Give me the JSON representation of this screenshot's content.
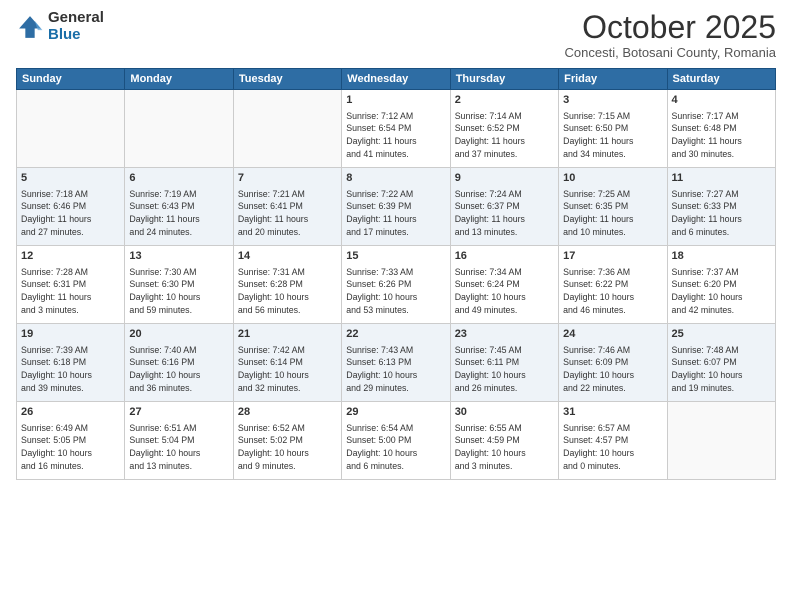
{
  "logo": {
    "general": "General",
    "blue": "Blue"
  },
  "title": "October 2025",
  "subtitle": "Concesti, Botosani County, Romania",
  "weekdays": [
    "Sunday",
    "Monday",
    "Tuesday",
    "Wednesday",
    "Thursday",
    "Friday",
    "Saturday"
  ],
  "weeks": [
    [
      {
        "day": "",
        "info": ""
      },
      {
        "day": "",
        "info": ""
      },
      {
        "day": "",
        "info": ""
      },
      {
        "day": "1",
        "info": "Sunrise: 7:12 AM\nSunset: 6:54 PM\nDaylight: 11 hours\nand 41 minutes."
      },
      {
        "day": "2",
        "info": "Sunrise: 7:14 AM\nSunset: 6:52 PM\nDaylight: 11 hours\nand 37 minutes."
      },
      {
        "day": "3",
        "info": "Sunrise: 7:15 AM\nSunset: 6:50 PM\nDaylight: 11 hours\nand 34 minutes."
      },
      {
        "day": "4",
        "info": "Sunrise: 7:17 AM\nSunset: 6:48 PM\nDaylight: 11 hours\nand 30 minutes."
      }
    ],
    [
      {
        "day": "5",
        "info": "Sunrise: 7:18 AM\nSunset: 6:46 PM\nDaylight: 11 hours\nand 27 minutes."
      },
      {
        "day": "6",
        "info": "Sunrise: 7:19 AM\nSunset: 6:43 PM\nDaylight: 11 hours\nand 24 minutes."
      },
      {
        "day": "7",
        "info": "Sunrise: 7:21 AM\nSunset: 6:41 PM\nDaylight: 11 hours\nand 20 minutes."
      },
      {
        "day": "8",
        "info": "Sunrise: 7:22 AM\nSunset: 6:39 PM\nDaylight: 11 hours\nand 17 minutes."
      },
      {
        "day": "9",
        "info": "Sunrise: 7:24 AM\nSunset: 6:37 PM\nDaylight: 11 hours\nand 13 minutes."
      },
      {
        "day": "10",
        "info": "Sunrise: 7:25 AM\nSunset: 6:35 PM\nDaylight: 11 hours\nand 10 minutes."
      },
      {
        "day": "11",
        "info": "Sunrise: 7:27 AM\nSunset: 6:33 PM\nDaylight: 11 hours\nand 6 minutes."
      }
    ],
    [
      {
        "day": "12",
        "info": "Sunrise: 7:28 AM\nSunset: 6:31 PM\nDaylight: 11 hours\nand 3 minutes."
      },
      {
        "day": "13",
        "info": "Sunrise: 7:30 AM\nSunset: 6:30 PM\nDaylight: 10 hours\nand 59 minutes."
      },
      {
        "day": "14",
        "info": "Sunrise: 7:31 AM\nSunset: 6:28 PM\nDaylight: 10 hours\nand 56 minutes."
      },
      {
        "day": "15",
        "info": "Sunrise: 7:33 AM\nSunset: 6:26 PM\nDaylight: 10 hours\nand 53 minutes."
      },
      {
        "day": "16",
        "info": "Sunrise: 7:34 AM\nSunset: 6:24 PM\nDaylight: 10 hours\nand 49 minutes."
      },
      {
        "day": "17",
        "info": "Sunrise: 7:36 AM\nSunset: 6:22 PM\nDaylight: 10 hours\nand 46 minutes."
      },
      {
        "day": "18",
        "info": "Sunrise: 7:37 AM\nSunset: 6:20 PM\nDaylight: 10 hours\nand 42 minutes."
      }
    ],
    [
      {
        "day": "19",
        "info": "Sunrise: 7:39 AM\nSunset: 6:18 PM\nDaylight: 10 hours\nand 39 minutes."
      },
      {
        "day": "20",
        "info": "Sunrise: 7:40 AM\nSunset: 6:16 PM\nDaylight: 10 hours\nand 36 minutes."
      },
      {
        "day": "21",
        "info": "Sunrise: 7:42 AM\nSunset: 6:14 PM\nDaylight: 10 hours\nand 32 minutes."
      },
      {
        "day": "22",
        "info": "Sunrise: 7:43 AM\nSunset: 6:13 PM\nDaylight: 10 hours\nand 29 minutes."
      },
      {
        "day": "23",
        "info": "Sunrise: 7:45 AM\nSunset: 6:11 PM\nDaylight: 10 hours\nand 26 minutes."
      },
      {
        "day": "24",
        "info": "Sunrise: 7:46 AM\nSunset: 6:09 PM\nDaylight: 10 hours\nand 22 minutes."
      },
      {
        "day": "25",
        "info": "Sunrise: 7:48 AM\nSunset: 6:07 PM\nDaylight: 10 hours\nand 19 minutes."
      }
    ],
    [
      {
        "day": "26",
        "info": "Sunrise: 6:49 AM\nSunset: 5:05 PM\nDaylight: 10 hours\nand 16 minutes."
      },
      {
        "day": "27",
        "info": "Sunrise: 6:51 AM\nSunset: 5:04 PM\nDaylight: 10 hours\nand 13 minutes."
      },
      {
        "day": "28",
        "info": "Sunrise: 6:52 AM\nSunset: 5:02 PM\nDaylight: 10 hours\nand 9 minutes."
      },
      {
        "day": "29",
        "info": "Sunrise: 6:54 AM\nSunset: 5:00 PM\nDaylight: 10 hours\nand 6 minutes."
      },
      {
        "day": "30",
        "info": "Sunrise: 6:55 AM\nSunset: 4:59 PM\nDaylight: 10 hours\nand 3 minutes."
      },
      {
        "day": "31",
        "info": "Sunrise: 6:57 AM\nSunset: 4:57 PM\nDaylight: 10 hours\nand 0 minutes."
      },
      {
        "day": "",
        "info": ""
      }
    ]
  ]
}
